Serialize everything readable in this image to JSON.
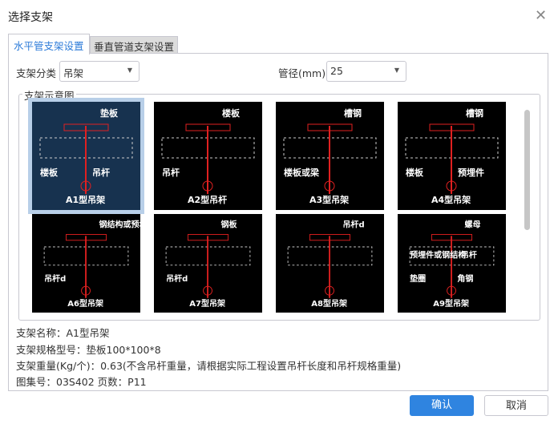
{
  "dialog": {
    "title": "选择支架",
    "close_icon": "close-icon"
  },
  "tabs": [
    {
      "label": "水平管支架设置",
      "active": true
    },
    {
      "label": "垂直管道支架设置",
      "active": false
    }
  ],
  "filters": {
    "category_label": "支架分类",
    "category_value": "吊架",
    "diameter_label": "管径(mm)",
    "diameter_value": "25"
  },
  "gallery": {
    "title": "支架示意图",
    "items": [
      {
        "name": "A1型吊架",
        "labels": [
          "垫板",
          "楼板",
          "吊杆"
        ],
        "selected": true
      },
      {
        "name": "A2型吊杆",
        "labels": [
          "楼板",
          "吊杆"
        ]
      },
      {
        "name": "A3型吊架",
        "labels": [
          "槽钢",
          "楼板或梁"
        ]
      },
      {
        "name": "A4型吊架",
        "labels": [
          "槽钢",
          "楼板",
          "预埋件"
        ]
      },
      {
        "name": "A6型吊架",
        "labels": [
          "钢结构或预埋件",
          "吊杆d"
        ]
      },
      {
        "name": "A7型吊架",
        "labels": [
          "钢板",
          "吊杆d"
        ]
      },
      {
        "name": "A8型吊架",
        "labels": [
          "吊杆d"
        ]
      },
      {
        "name": "A9型吊架",
        "labels": [
          "螺母",
          "垫圈",
          "角钢",
          "吊杆",
          "预埋件或钢结构"
        ]
      }
    ]
  },
  "info": {
    "name": "支架名称：A1型吊架",
    "spec": "支架规格型号：垫板100*100*8",
    "weight": "支架重量(Kg/个)：0.63(不含吊杆重量，请根据实际工程设置吊杆长度和吊杆规格重量)",
    "atlas": "图集号：03S402  页数：P11"
  },
  "buttons": {
    "ok": "确认",
    "cancel": "取消"
  },
  "colors": {
    "accent": "#2f84e0",
    "tab_active": "#2b7ad8"
  }
}
